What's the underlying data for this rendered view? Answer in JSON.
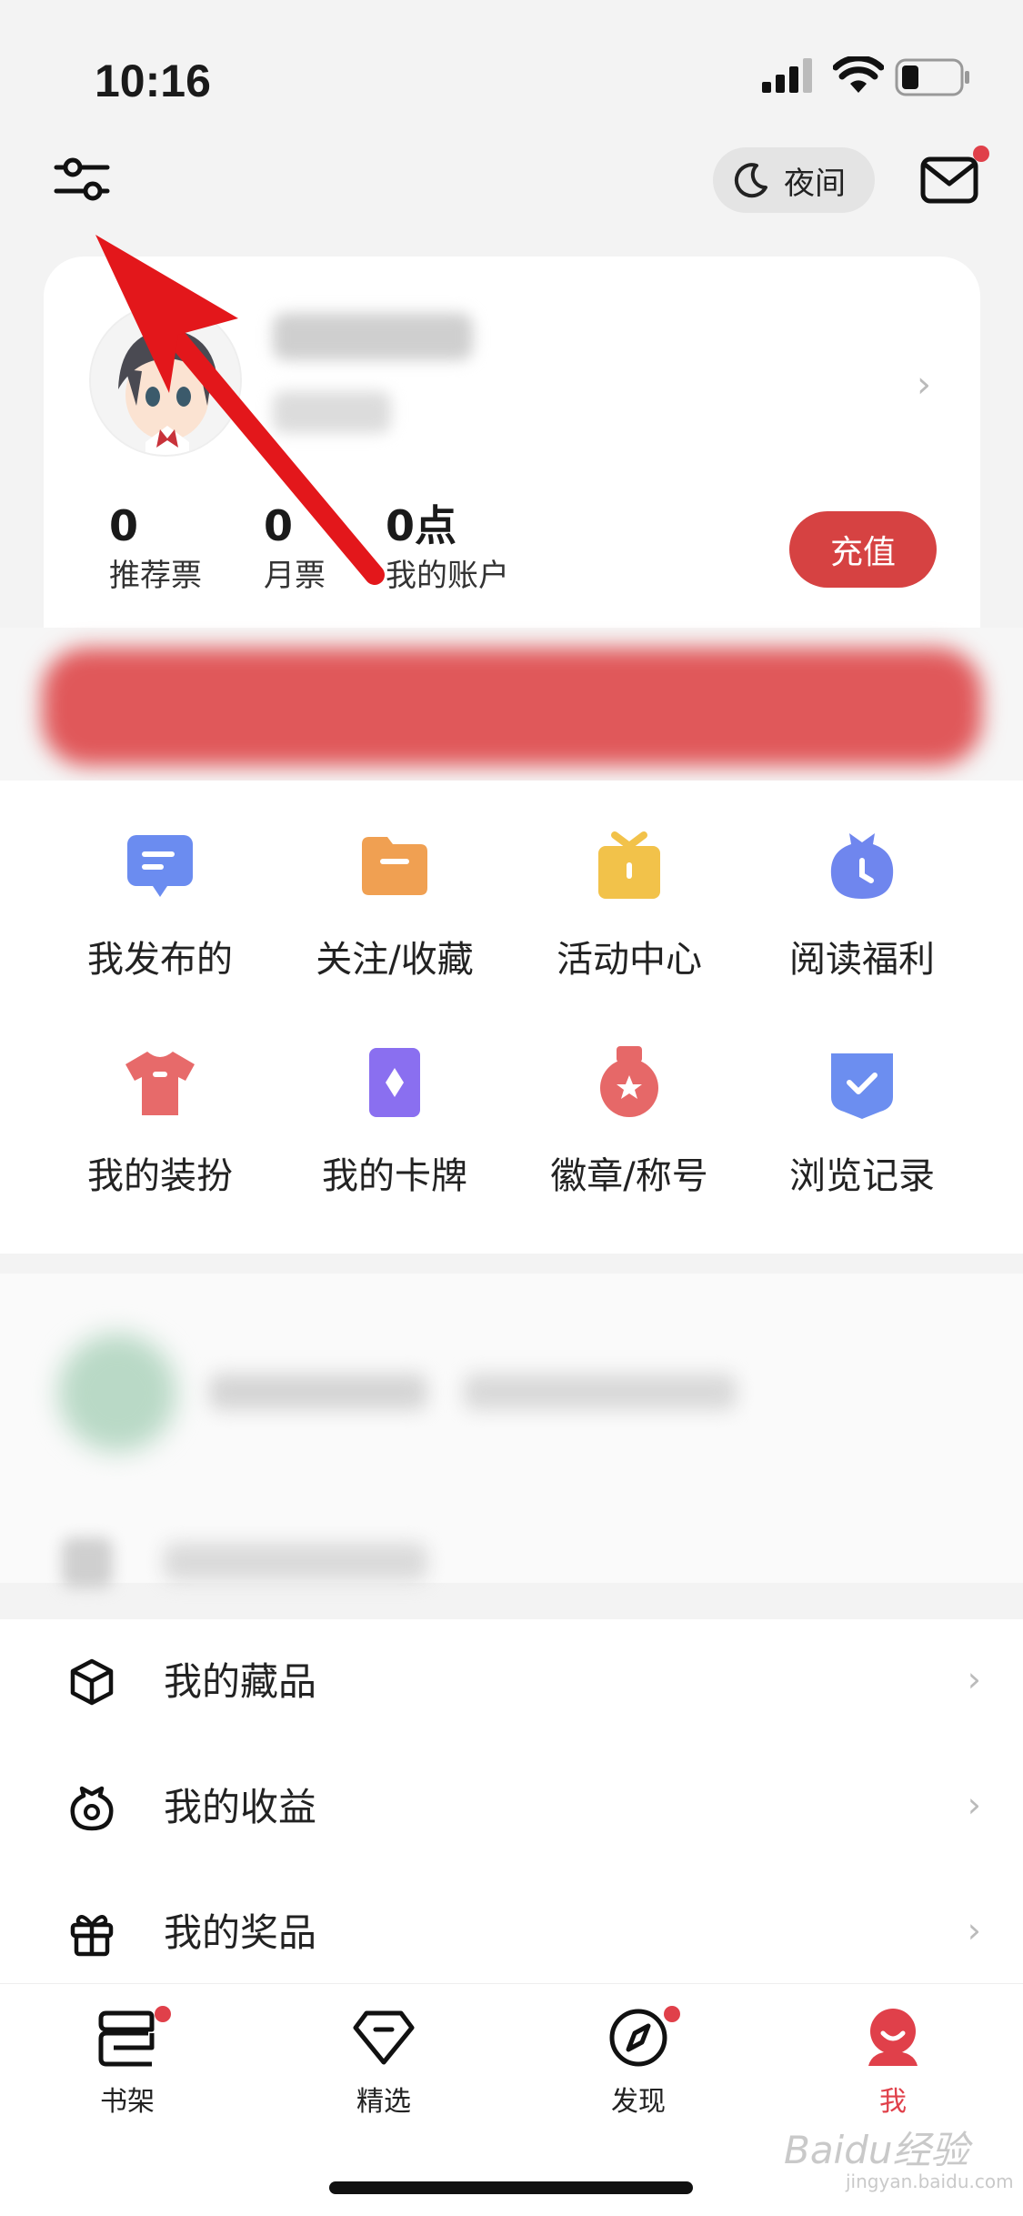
{
  "status_bar": {
    "time": "10:16"
  },
  "top_bar": {
    "night_label": "夜间"
  },
  "profile": {
    "stats": [
      {
        "value": "0",
        "label": "推荐票"
      },
      {
        "value": "0",
        "label": "月票"
      },
      {
        "value": "0点",
        "label": "我的账户"
      }
    ],
    "recharge_label": "充值"
  },
  "grid": {
    "items": [
      {
        "label": "我发布的",
        "icon": "comment-icon",
        "color": "#6b8cf0"
      },
      {
        "label": "关注/收藏",
        "icon": "folder-icon",
        "color": "#f0a052"
      },
      {
        "label": "活动中心",
        "icon": "gift-box-icon",
        "color": "#f2c24a"
      },
      {
        "label": "阅读福利",
        "icon": "clock-bag-icon",
        "color": "#6f86ee"
      },
      {
        "label": "我的装扮",
        "icon": "tshirt-icon",
        "color": "#e76a6a"
      },
      {
        "label": "我的卡牌",
        "icon": "card-icon",
        "color": "#8a6ff0"
      },
      {
        "label": "徽章/称号",
        "icon": "medal-icon",
        "color": "#e66868"
      },
      {
        "label": "浏览记录",
        "icon": "shield-check-icon",
        "color": "#6c8ef0"
      }
    ]
  },
  "list": {
    "items": [
      {
        "label": "我的藏品",
        "icon": "cube-icon"
      },
      {
        "label": "我的收益",
        "icon": "coin-bag-icon"
      },
      {
        "label": "我的奖品",
        "icon": "gift-icon"
      }
    ]
  },
  "tab_bar": {
    "tabs": [
      {
        "label": "书架",
        "icon": "bookshelf-icon",
        "badge": true
      },
      {
        "label": "精选",
        "icon": "diamond-icon",
        "badge": false
      },
      {
        "label": "发现",
        "icon": "compass-icon",
        "badge": true
      },
      {
        "label": "我",
        "icon": "profile-icon",
        "badge": false,
        "active": true
      }
    ],
    "active_color": "#e0404a"
  },
  "watermark": {
    "text": "Baidu经验",
    "sub": "jingyan.baidu.com"
  }
}
